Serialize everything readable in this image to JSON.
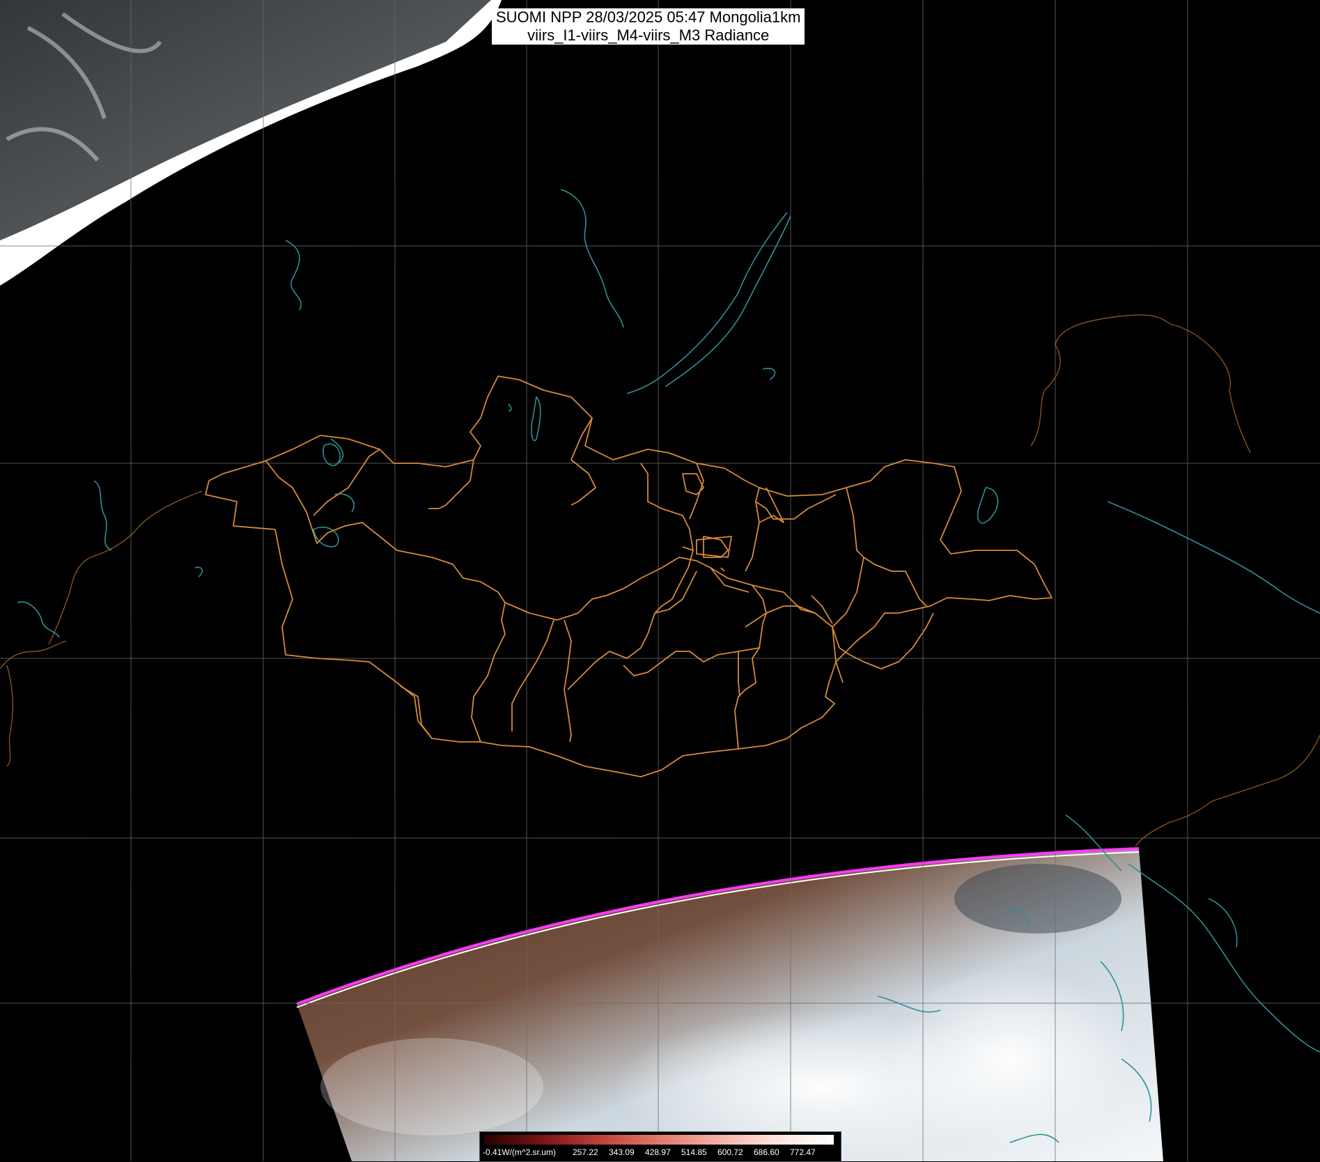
{
  "title": {
    "line1": "SUOMI NPP 28/03/2025 05:47 Mongolia1km",
    "line2": "viirs_I1-viirs_M4-viirs_M3 Radiance"
  },
  "colorbar": {
    "unit_label": "-0.41W/(m^2.sr.um)",
    "ticks": [
      "257.22",
      "343.09",
      "428.97",
      "514.85",
      "600.72",
      "686.60",
      "772.47"
    ]
  },
  "colors": {
    "background": "#000000",
    "graticule": "#6b6b6b",
    "province_borders": "#d68a3c",
    "coast_rivers": "#2f8f96",
    "swath_edge": "#ff33ff"
  }
}
